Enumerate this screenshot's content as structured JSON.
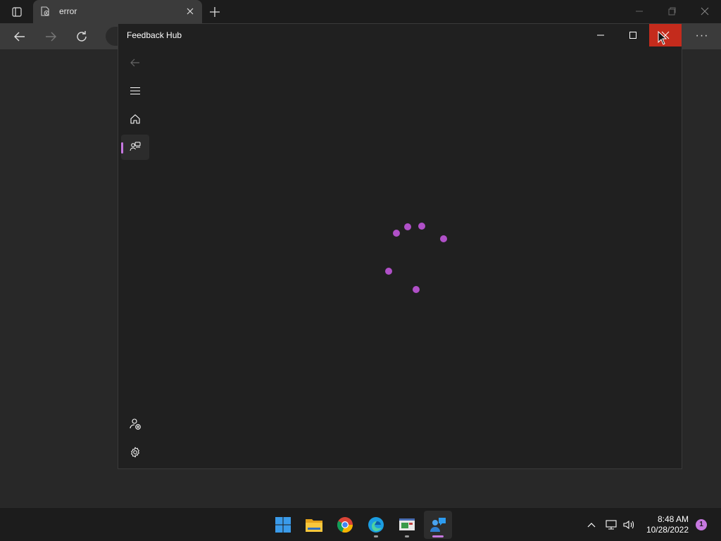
{
  "browser": {
    "tab_title": "error",
    "more_label": "···"
  },
  "feedback_hub": {
    "title": "Feedback Hub",
    "nav": [
      {
        "name": "back",
        "icon": "back-arrow-icon"
      },
      {
        "name": "menu",
        "icon": "hamburger-menu-icon"
      },
      {
        "name": "home",
        "icon": "home-icon"
      },
      {
        "name": "feedback",
        "icon": "feedback-icon",
        "selected": true
      },
      {
        "name": "account",
        "icon": "add-account-icon"
      },
      {
        "name": "settings",
        "icon": "gear-icon"
      }
    ],
    "loading": true,
    "accent": "#c678e0",
    "close_color": "#c42b1c"
  },
  "taskbar": {
    "apps": [
      {
        "name": "start",
        "icon": "windows-start-icon"
      },
      {
        "name": "file-explorer",
        "icon": "folder-icon"
      },
      {
        "name": "chrome",
        "icon": "chrome-icon"
      },
      {
        "name": "edge",
        "icon": "edge-icon",
        "running": true
      },
      {
        "name": "app-window",
        "icon": "window-app-icon",
        "running": true
      },
      {
        "name": "feedback-hub",
        "icon": "feedback-hub-icon",
        "active": true
      }
    ],
    "time": "8:48 AM",
    "date": "10/28/2022",
    "notification_count": "1"
  }
}
